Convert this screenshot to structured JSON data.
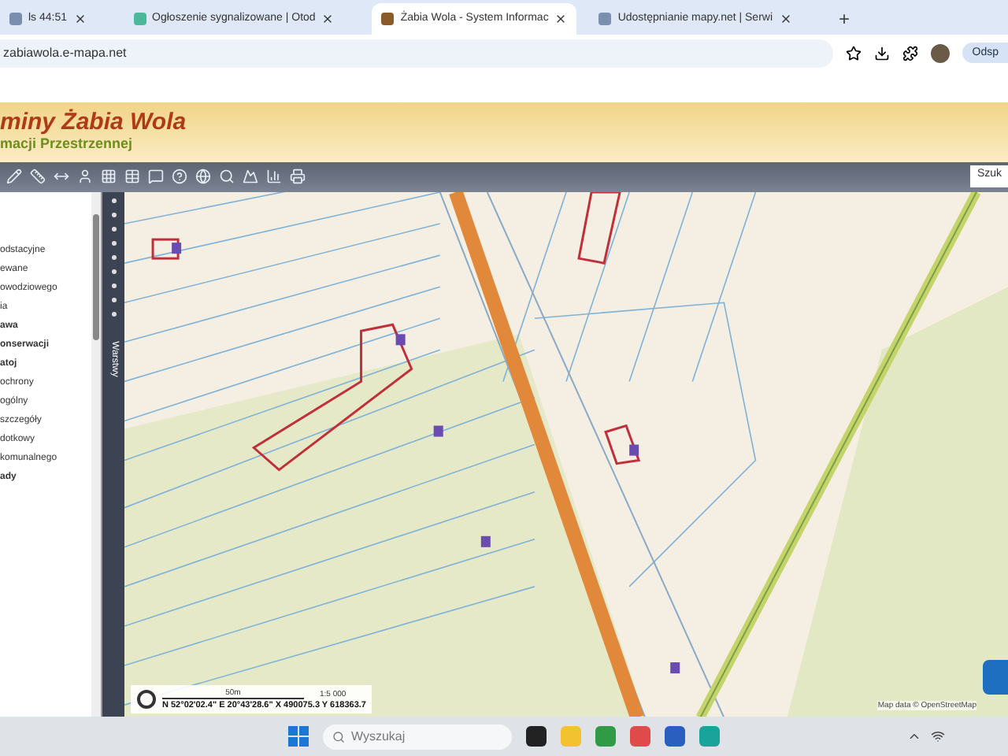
{
  "browser": {
    "tabs": [
      {
        "title": "ls 44:51",
        "selected": false
      },
      {
        "title": "Ogłoszenie sygnalizowane | Otod",
        "selected": false
      },
      {
        "title": "Żabia Wola - System Informac",
        "selected": true
      },
      {
        "title": "Udostępnianie mapy.net | Serwi",
        "selected": false
      }
    ],
    "new_tab": "+",
    "address": "zabiawola.e-mapa.net",
    "profile_button": "Odsp"
  },
  "header": {
    "title": "miny Żabia Wola",
    "subtitle": "macji Przestrzennej"
  },
  "toolbar": {
    "search_label": "Szuk"
  },
  "layers": {
    "items": [
      {
        "label": "odstacyjne",
        "kind": "item"
      },
      {
        "label": "ewane",
        "kind": "item"
      },
      {
        "label": "owodziowego",
        "kind": "item"
      },
      {
        "label": "ia",
        "kind": "item"
      },
      {
        "label": "awa",
        "kind": "header"
      },
      {
        "label": "onserwacji",
        "kind": "header"
      },
      {
        "label": "atoj",
        "kind": "header"
      },
      {
        "label": "ochrony",
        "kind": "item"
      },
      {
        "label": "ogólny",
        "kind": "item"
      },
      {
        "label": "szczegóły",
        "kind": "item"
      },
      {
        "label": "dotkowy",
        "kind": "item"
      },
      {
        "label": "komunalnego",
        "kind": "item"
      },
      {
        "label": "ady",
        "kind": "header"
      }
    ],
    "side_tab": "Warstwy"
  },
  "map": {
    "scale_label": "50m",
    "scale_select": "1:5 000",
    "coordinates": "N 52°02'02.4\" E 20°43'28.6\" X 490075.3 Y 618363.7",
    "attribution": "Map data © OpenStreetMap"
  },
  "taskbar": {
    "search_placeholder": "Wyszukaj"
  }
}
